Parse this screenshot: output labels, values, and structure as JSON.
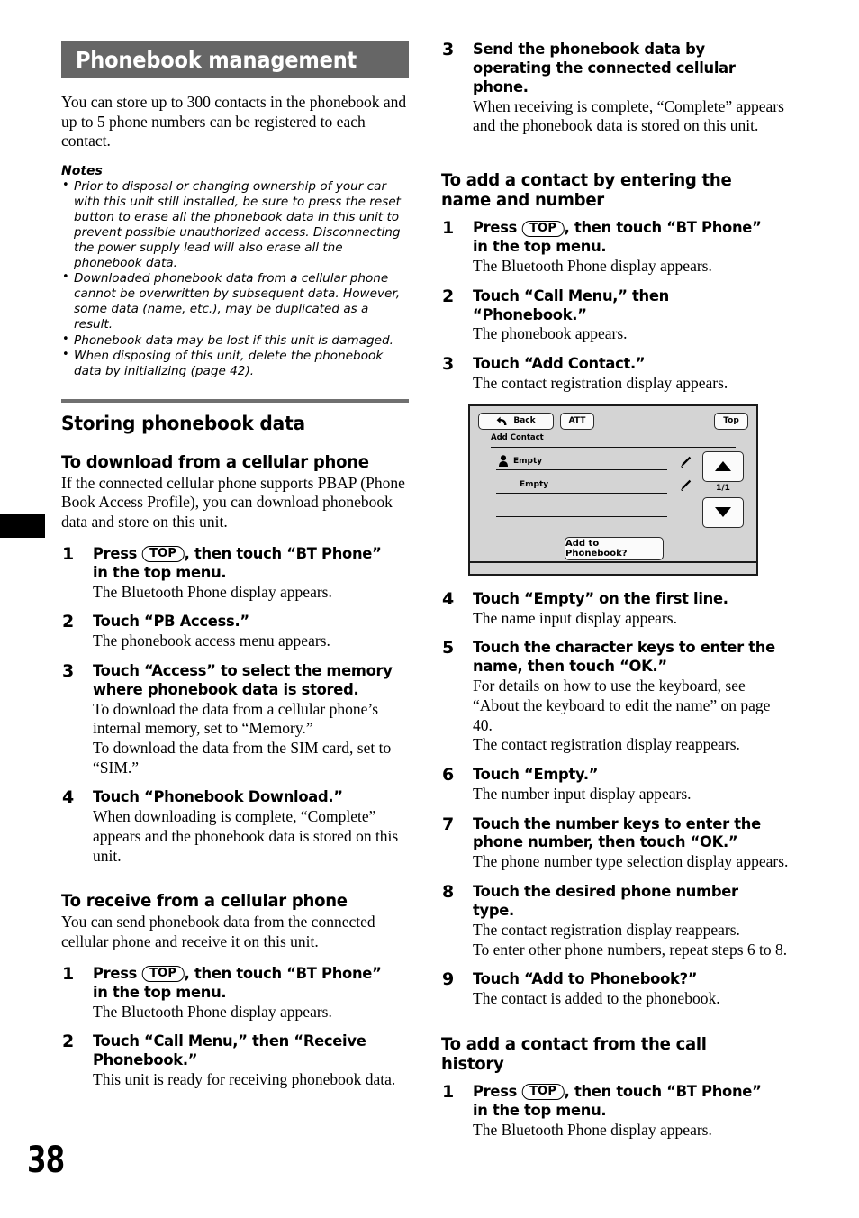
{
  "page": {
    "number": "38"
  },
  "banner": {
    "title": "Phonebook management"
  },
  "intro": "You can store up to 300 contacts in the phonebook and up to 5 phone numbers can be registered to each contact.",
  "notes": {
    "label": "Notes",
    "items": [
      "Prior to disposal or changing ownership of your car with this unit still installed, be sure to press the reset button to erase all the phonebook data in this unit to prevent possible unauthorized access. Disconnecting the power supply lead will also erase all the phonebook data.",
      "Downloaded phonebook data from a cellular phone cannot be overwritten by subsequent data. However, some data (name, etc.), may be duplicated as a result.",
      "Phonebook data may be lost if this unit is damaged.",
      "When disposing of this unit, delete the phonebook data by initializing (page 42)."
    ]
  },
  "section_storing": {
    "heading": "Storing phonebook data"
  },
  "sub_download": {
    "heading": "To download from a cellular phone",
    "body": "If the connected cellular phone supports PBAP (Phone Book Access Profile), you can download phonebook data and store on this unit.",
    "steps": [
      {
        "num": "1",
        "title_before": "Press ",
        "key": "TOP",
        "title_after": ", then touch “BT Phone” in the top menu.",
        "body": "The Bluetooth Phone display appears."
      },
      {
        "num": "2",
        "title": "Touch “PB Access.”",
        "body": "The phonebook access menu appears."
      },
      {
        "num": "3",
        "title": "Touch “Access” to select the memory where phonebook data is stored.",
        "body": "To download the data from a cellular phone’s internal memory, set to “Memory.”\nTo download the data from the SIM card, set to “SIM.”"
      },
      {
        "num": "4",
        "title": "Touch “Phonebook Download.”",
        "body": "When downloading is complete, “Complete” appears and the phonebook data is stored on this unit."
      }
    ]
  },
  "sub_receive": {
    "heading": "To receive from a cellular phone",
    "body": "You can send phonebook data from the connected cellular phone and receive it on this unit.",
    "steps": [
      {
        "num": "1",
        "title_before": "Press ",
        "key": "TOP",
        "title_after": ", then touch “BT Phone” in the top menu.",
        "body": "The Bluetooth Phone display appears."
      },
      {
        "num": "2",
        "title": "Touch “Call Menu,” then “Receive Phonebook.”",
        "body": "This unit is ready for receiving phonebook data."
      },
      {
        "num": "3",
        "title": "Send the phonebook data by operating the connected cellular phone.",
        "body": "When receiving is complete, “Complete” appears and the phonebook data is stored on this unit."
      }
    ]
  },
  "sub_addname": {
    "heading": "To add a contact by entering the name and number",
    "steps_before_fig": [
      {
        "num": "1",
        "title_before": "Press ",
        "key": "TOP",
        "title_after": ", then touch “BT Phone” in the top menu.",
        "body": "The Bluetooth Phone display appears."
      },
      {
        "num": "2",
        "title": "Touch “Call Menu,” then “Phonebook.”",
        "body": "The phonebook appears."
      },
      {
        "num": "3",
        "title": "Touch “Add Contact.”",
        "body": "The contact registration display appears."
      }
    ],
    "steps_after_fig": [
      {
        "num": "4",
        "title": "Touch “Empty” on the first line.",
        "body": "The name input display appears."
      },
      {
        "num": "5",
        "title": "Touch the character keys to enter the name, then touch “OK.”",
        "body": "For details on how to use the keyboard, see “About the keyboard to edit the name” on page 40.\nThe contact registration display reappears."
      },
      {
        "num": "6",
        "title": "Touch “Empty.”",
        "body": "The number input display appears."
      },
      {
        "num": "7",
        "title": "Touch the number keys to enter the phone number, then touch “OK.”",
        "body": "The phone number type selection display appears."
      },
      {
        "num": "8",
        "title": "Touch the desired phone number type.",
        "body": "The contact registration display reappears.\nTo enter other phone numbers, repeat steps 6 to 8."
      },
      {
        "num": "9",
        "title": "Touch “Add to Phonebook?”",
        "body": "The contact is added to the phonebook."
      }
    ]
  },
  "sub_callhistory": {
    "heading": "To add a contact from the call history",
    "steps": [
      {
        "num": "1",
        "title_before": "Press ",
        "key": "TOP",
        "title_after": ", then touch “BT Phone” in the top menu.",
        "body": "The Bluetooth Phone display appears."
      }
    ]
  },
  "screen_figure": {
    "back_button": "Back",
    "att_button": "ATT",
    "top_button": "Top",
    "title_label": "Add Contact",
    "row1_value": "Empty",
    "row2_value": "Empty",
    "page_indicator": "1/1",
    "add_button": "Add to Phonebook?",
    "colors": {
      "screen_background": "#d4d4d4",
      "button_face": "#fbfbfb",
      "outline": "#1a1a1a"
    }
  },
  "colors": {
    "banner_background": "#666666",
    "banner_text": "#ffffff",
    "rule": "#707070"
  }
}
